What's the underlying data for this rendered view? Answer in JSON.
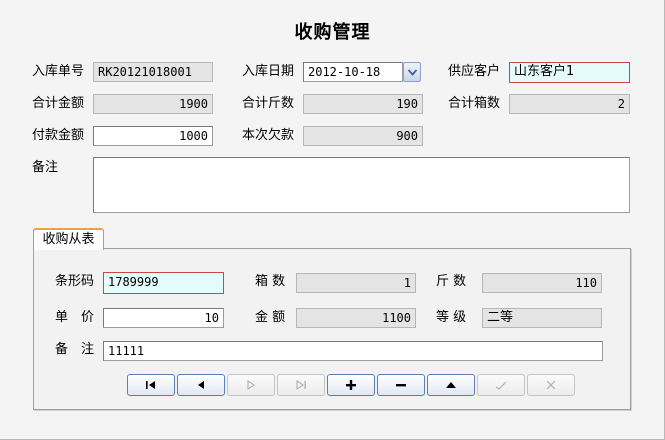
{
  "window": {
    "title": "收购管理"
  },
  "header": {
    "order_no": {
      "label": "入库单号",
      "value": "RK20121018001"
    },
    "date": {
      "label": "入库日期",
      "value": "2012-10-18"
    },
    "supplier": {
      "label": "供应客户",
      "value": "山东客户1"
    },
    "total_amount": {
      "label": "合计金额",
      "value": "1900"
    },
    "total_jin": {
      "label": "合计斤数",
      "value": "190"
    },
    "total_boxes": {
      "label": "合计箱数",
      "value": "2"
    },
    "paid": {
      "label": "付款金额",
      "value": "1000"
    },
    "owed": {
      "label": "本次欠款",
      "value": "900"
    },
    "remark": {
      "label": "备注",
      "value": ""
    }
  },
  "detail_tab": {
    "label": "收购从表"
  },
  "detail": {
    "barcode": {
      "label": "条形码",
      "value": "1789999"
    },
    "boxes": {
      "label": "箱 数",
      "value": "1"
    },
    "jin": {
      "label": "斤 数",
      "value": "110"
    },
    "unit_price": {
      "label": "单　价",
      "value": "10"
    },
    "amount": {
      "label": "金 额",
      "value": "1100"
    },
    "grade": {
      "label": "等 级",
      "value": "二等"
    },
    "remark": {
      "label": "备　注",
      "value": "11111"
    }
  },
  "navigator": [
    {
      "name": "first-record",
      "icon": "skip-first-icon",
      "enabled": true
    },
    {
      "name": "prior-record",
      "icon": "prior-icon",
      "enabled": true
    },
    {
      "name": "next-record",
      "icon": "next-icon",
      "enabled": false
    },
    {
      "name": "last-record",
      "icon": "skip-last-icon",
      "enabled": false
    },
    {
      "name": "insert-record",
      "icon": "plus-icon",
      "enabled": true
    },
    {
      "name": "delete-record",
      "icon": "minus-icon",
      "enabled": true
    },
    {
      "name": "edit-record",
      "icon": "edit-icon",
      "enabled": true
    },
    {
      "name": "post-record",
      "icon": "check-icon",
      "enabled": false
    },
    {
      "name": "cancel-record",
      "icon": "cancel-icon",
      "enabled": false
    }
  ],
  "colors": {
    "highlight_border": "#c84848",
    "highlight_bg": "#e6fbfc",
    "tab_accent": "#f0a03c"
  }
}
